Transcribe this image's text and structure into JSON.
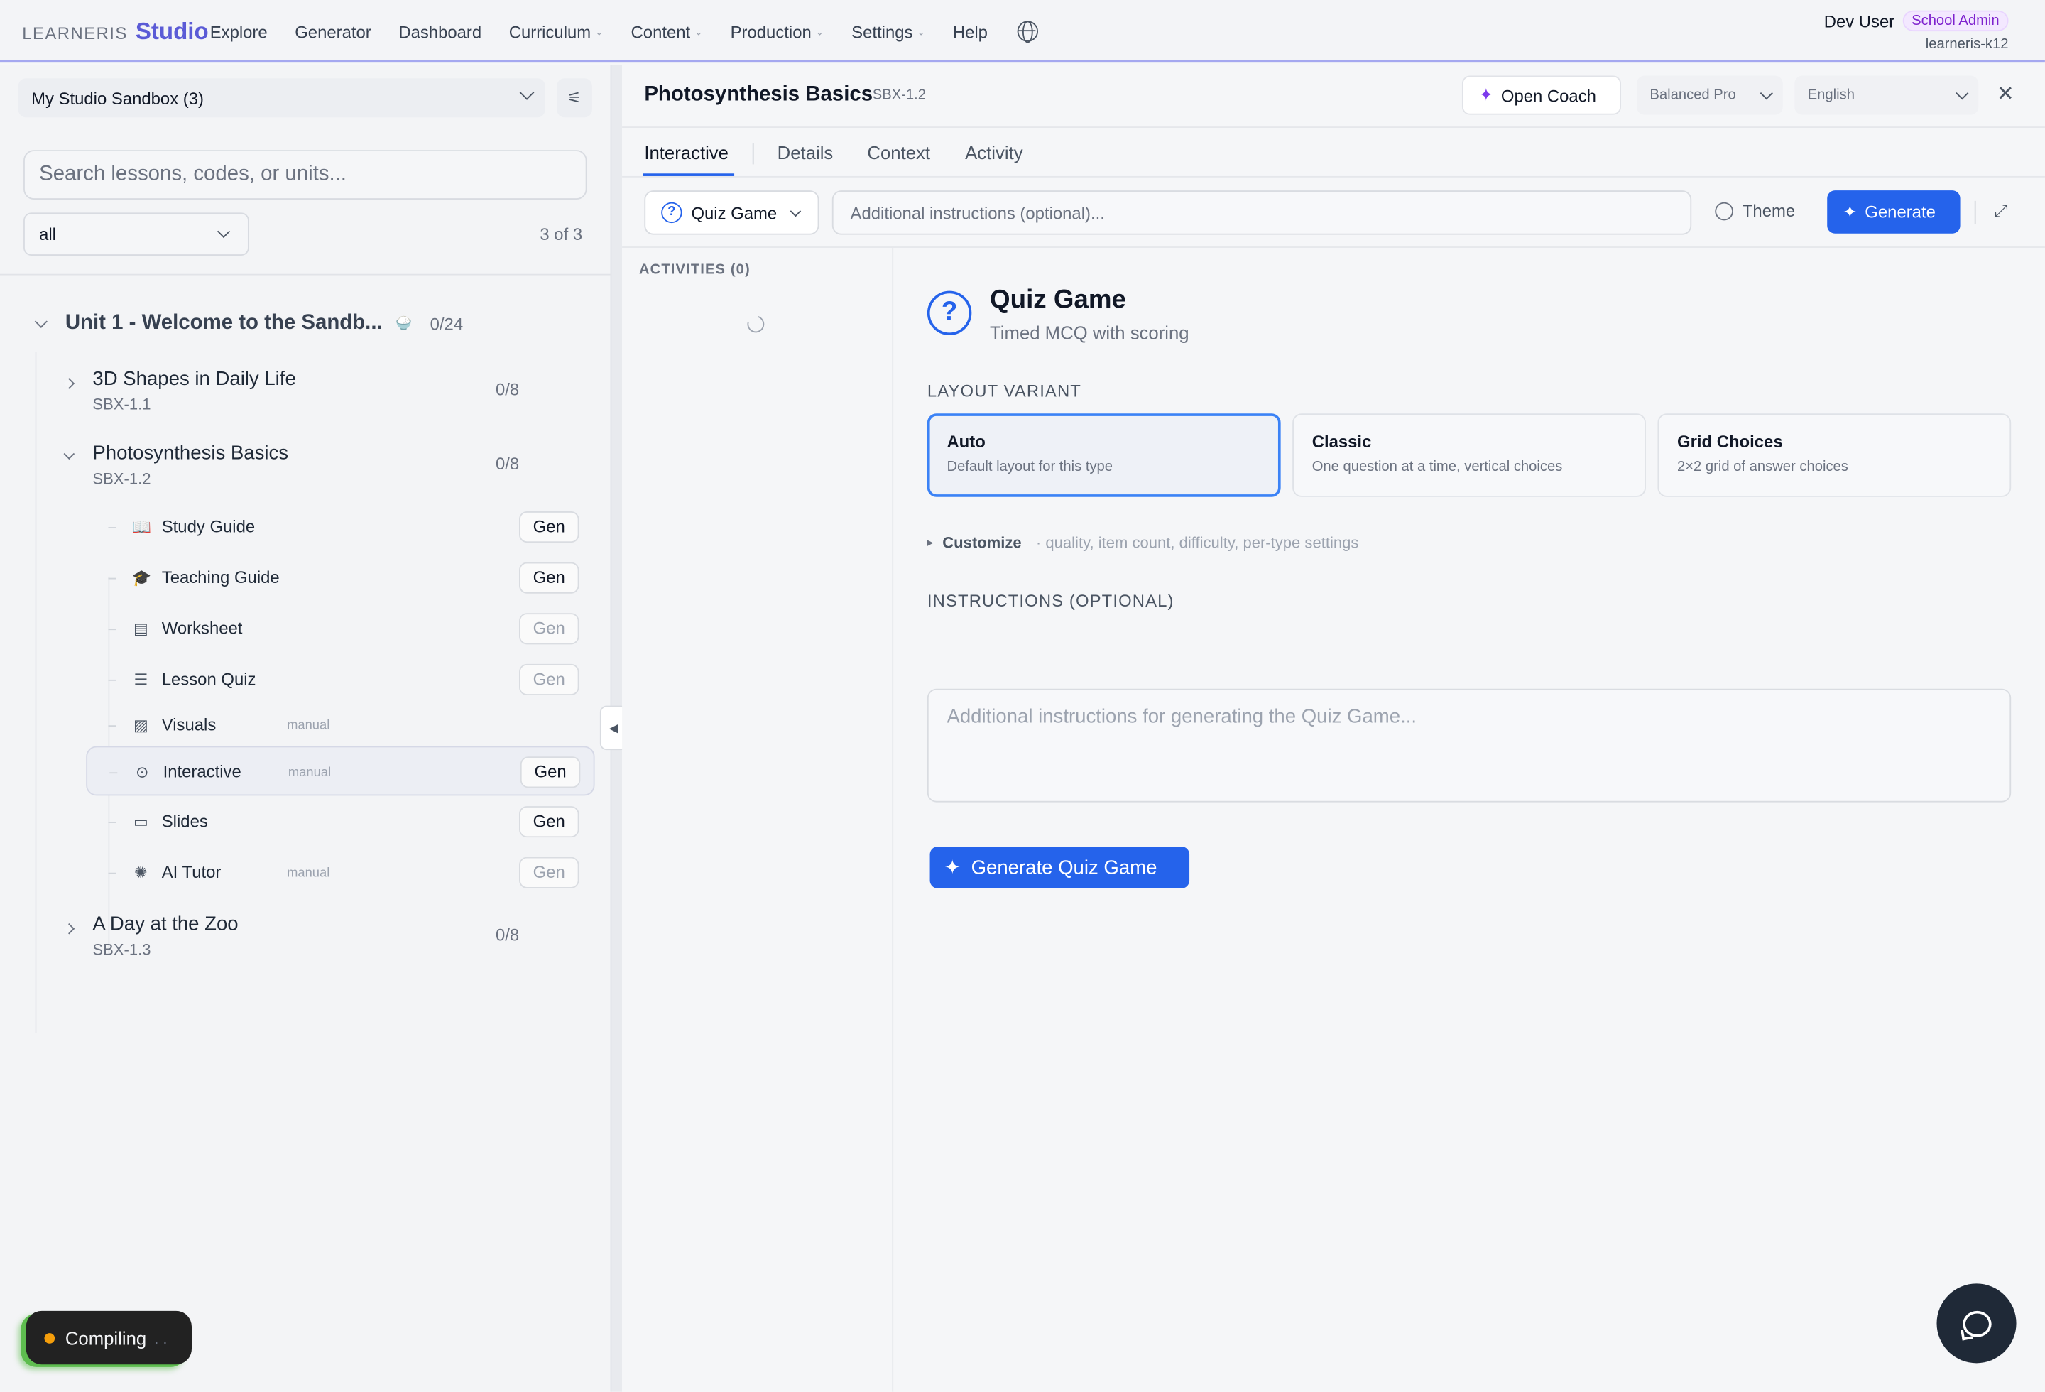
{
  "brand": {
    "prefix": "LEARNERIS",
    "name": "Studio"
  },
  "nav": {
    "explore": "Explore",
    "generator": "Generator",
    "dashboard": "Dashboard",
    "curriculum": "Curriculum",
    "content": "Content",
    "production": "Production",
    "settings": "Settings",
    "help": "Help"
  },
  "user": {
    "name": "Dev User",
    "role": "School Admin",
    "tenant": "learneris-k12"
  },
  "sidebar": {
    "sandbox": "My Studio Sandbox (3)",
    "search_placeholder": "Search lessons, codes, or units...",
    "filter_value": "all",
    "count": "3 of 3",
    "unit": {
      "title": "Unit 1 - Welcome to the Sandb...",
      "emoji": "🍚",
      "count": "0/24"
    },
    "lessons": [
      {
        "title": "3D Shapes in Daily Life",
        "code": "SBX-1.1",
        "count": "0/8"
      },
      {
        "title": "Photosynthesis Basics",
        "code": "SBX-1.2",
        "count": "0/8"
      },
      {
        "title": "A Day at the Zoo",
        "code": "SBX-1.3",
        "count": "0/8"
      }
    ],
    "items": [
      {
        "label": "Study Guide",
        "manual": "",
        "gen": "Gen"
      },
      {
        "label": "Teaching Guide",
        "manual": "",
        "gen": "Gen"
      },
      {
        "label": "Worksheet",
        "manual": "",
        "gen": "Gen"
      },
      {
        "label": "Lesson Quiz",
        "manual": "",
        "gen": "Gen"
      },
      {
        "label": "Visuals",
        "manual": "manual",
        "gen": ""
      },
      {
        "label": "Interactive",
        "manual": "manual",
        "gen": "Gen"
      },
      {
        "label": "Slides",
        "manual": "",
        "gen": "Gen"
      },
      {
        "label": "AI Tutor",
        "manual": "manual",
        "gen": "Gen"
      }
    ]
  },
  "status": {
    "label": "Compiling",
    "dots": ". ."
  },
  "detail": {
    "title": "Photosynthesis Basics",
    "code": "SBX-1.2",
    "open_coach": "Open Coach",
    "model": "Balanced Pro",
    "language": "English",
    "tabs": [
      "Interactive",
      "Details",
      "Context",
      "Activity"
    ],
    "type": "Quiz Game",
    "instructions_placeholder": "Additional instructions (optional)...",
    "theme": "Theme",
    "generate": "Generate",
    "activities_label": "ACTIVITIES (0)"
  },
  "editor": {
    "title": "Quiz Game",
    "subtitle": "Timed MCQ with scoring",
    "layout_label": "LAYOUT VARIANT",
    "variants": [
      {
        "title": "Auto",
        "desc": "Default layout for this type"
      },
      {
        "title": "Classic",
        "desc": "One question at a time, vertical choices"
      },
      {
        "title": "Grid Choices",
        "desc": "2×2 grid of answer choices"
      }
    ],
    "customize_label": "Customize",
    "customize_hint": "· quality, item count, difficulty, per-type settings",
    "instructions_label": "INSTRUCTIONS (OPTIONAL)",
    "instructions_placeholder": "Additional instructions for generating the Quiz Game...",
    "generate_button": "Generate Quiz Game"
  },
  "colors": {
    "accent": "#2563eb",
    "brand": "#5b5bd6",
    "admin_badge": "#7e22ce"
  }
}
